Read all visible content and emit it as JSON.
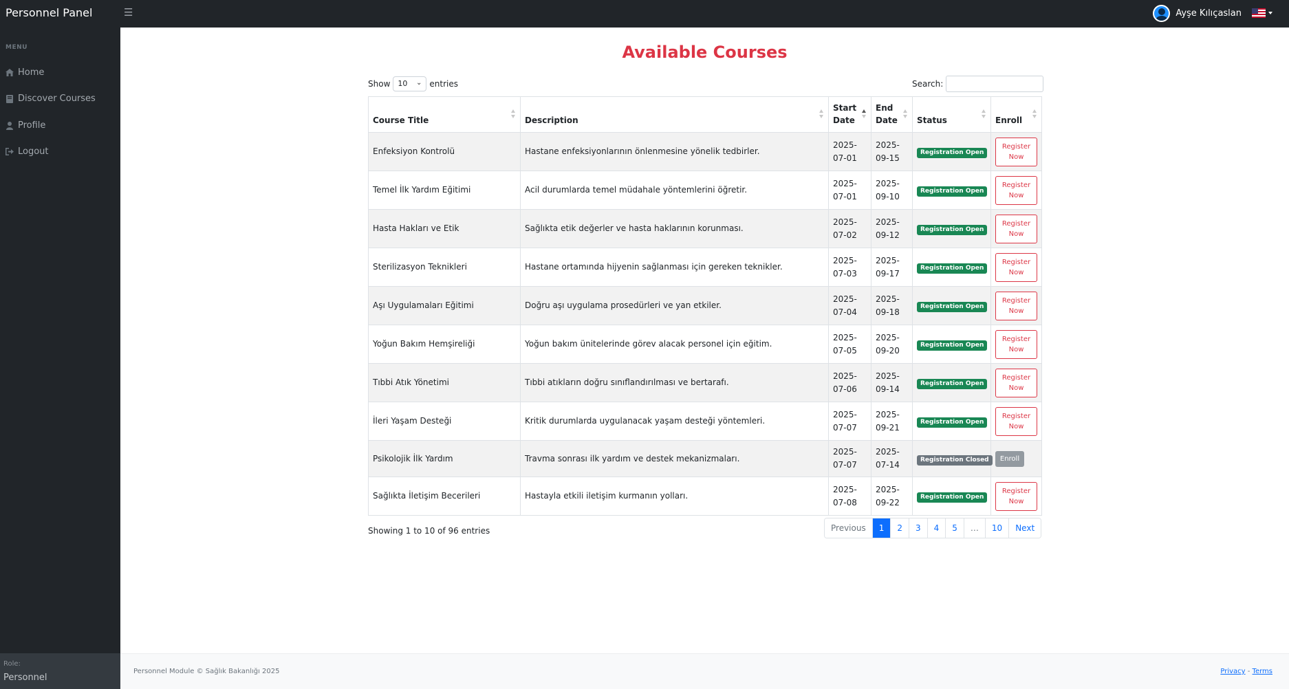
{
  "app": {
    "brand": "Personnel Panel"
  },
  "header": {
    "user_name": "Ayşe Kılıçaslan",
    "language_flag": "us-flag-icon"
  },
  "sidebar": {
    "menu_heading": "MENU",
    "items": [
      {
        "label": "Home",
        "icon": "home-icon"
      },
      {
        "label": "Discover Courses",
        "icon": "book-icon"
      },
      {
        "label": "Profile",
        "icon": "user-icon"
      },
      {
        "label": "Logout",
        "icon": "logout-icon"
      }
    ],
    "role_label": "Role:",
    "role_value": "Personnel"
  },
  "main": {
    "title": "Available Courses",
    "show_prefix": "Show",
    "show_value": "10",
    "show_suffix": "entries",
    "search_label": "Search:",
    "search_value": "",
    "columns": [
      "Course Title",
      "Description",
      "Start Date",
      "End Date",
      "Status",
      "Enroll"
    ],
    "rows": [
      {
        "title": "Enfeksiyon Kontrolü",
        "description": "Hastane enfeksiyonlarının önlenmesine yönelik tedbirler.",
        "start": "2025-07-01",
        "end": "2025-09-15",
        "status": "Registration Open",
        "action": "Register Now"
      },
      {
        "title": "Temel İlk Yardım Eğitimi",
        "description": "Acil durumlarda temel müdahale yöntemlerini öğretir.",
        "start": "2025-07-01",
        "end": "2025-09-10",
        "status": "Registration Open",
        "action": "Register Now"
      },
      {
        "title": "Hasta Hakları ve Etik",
        "description": "Sağlıkta etik değerler ve hasta haklarının korunması.",
        "start": "2025-07-02",
        "end": "2025-09-12",
        "status": "Registration Open",
        "action": "Register Now"
      },
      {
        "title": "Sterilizasyon Teknikleri",
        "description": "Hastane ortamında hijyenin sağlanması için gereken teknikler.",
        "start": "2025-07-03",
        "end": "2025-09-17",
        "status": "Registration Open",
        "action": "Register Now"
      },
      {
        "title": "Aşı Uygulamaları Eğitimi",
        "description": "Doğru aşı uygulama prosedürleri ve yan etkiler.",
        "start": "2025-07-04",
        "end": "2025-09-18",
        "status": "Registration Open",
        "action": "Register Now"
      },
      {
        "title": "Yoğun Bakım Hemşireliği",
        "description": "Yoğun bakım ünitelerinde görev alacak personel için eğitim.",
        "start": "2025-07-05",
        "end": "2025-09-20",
        "status": "Registration Open",
        "action": "Register Now"
      },
      {
        "title": "Tıbbi Atık Yönetimi",
        "description": "Tıbbi atıkların doğru sınıflandırılması ve bertarafı.",
        "start": "2025-07-06",
        "end": "2025-09-14",
        "status": "Registration Open",
        "action": "Register Now"
      },
      {
        "title": "İleri Yaşam Desteği",
        "description": "Kritik durumlarda uygulanacak yaşam desteği yöntemleri.",
        "start": "2025-07-07",
        "end": "2025-09-21",
        "status": "Registration Open",
        "action": "Register Now"
      },
      {
        "title": "Psikolojik İlk Yardım",
        "description": "Travma sonrası ilk yardım ve destek mekanizmaları.",
        "start": "2025-07-07",
        "end": "2025-07-14",
        "status": "Registration Closed",
        "action": "Enroll"
      },
      {
        "title": "Sağlıkta İletişim Becerileri",
        "description": "Hastayla etkili iletişim kurmanın yolları.",
        "start": "2025-07-08",
        "end": "2025-09-22",
        "status": "Registration Open",
        "action": "Register Now"
      }
    ],
    "info": "Showing 1 to 10 of 96 entries",
    "pagination": [
      "Previous",
      "1",
      "2",
      "3",
      "4",
      "5",
      "…",
      "10",
      "Next"
    ],
    "active_page": "1"
  },
  "footer": {
    "text": "Personnel Module © Sağlık Bakanlığı 2025",
    "privacy": "Privacy",
    "separator": " - ",
    "terms": "Terms"
  },
  "colors": {
    "accent": "#dc3545",
    "sidebar": "#212529",
    "badge_open": "#198754",
    "badge_closed": "#6c757d",
    "link": "#0d6efd"
  }
}
